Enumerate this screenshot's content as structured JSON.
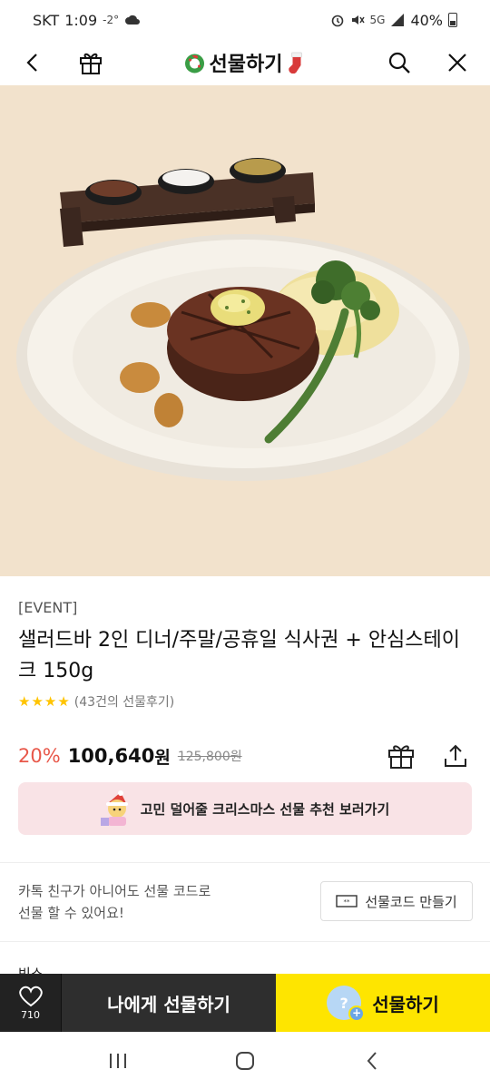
{
  "status_bar": {
    "carrier": "SKT",
    "time": "1:09",
    "temp": "-2°",
    "battery": "40%",
    "network": "5G"
  },
  "header": {
    "title": "선물하기",
    "icons": [
      "back-icon",
      "gift-box-icon",
      "wreath-icon",
      "stocking-icon",
      "search-icon",
      "close-icon"
    ]
  },
  "product": {
    "event_tag": "[EVENT]",
    "title": "샐러드바 2인 디너/주말/공휴일 식사권 + 안심스테이크 150g",
    "stars": "★★★★",
    "review_count": "(43건의 선물후기)",
    "discount": "20%",
    "price": "100,640",
    "price_unit": "원",
    "original_price": "125,800원"
  },
  "banner": {
    "text": "고민 덜어줄 크리스마스 선물 추천 보러가기"
  },
  "gift_code": {
    "note_line1": "카톡 친구가 아니어도 선물 코드로",
    "note_line2": "선물 할 수 있어요!",
    "button_label": "선물코드 만들기"
  },
  "peek_text": "빈스",
  "bottom_bar": {
    "wish_count": "710",
    "gift_to_me": "나에게 선물하기",
    "gift": "선물하기"
  },
  "colors": {
    "discount": "#e8584a",
    "gift_button": "#fee500",
    "gift_to_me_button": "#2e2e2e",
    "banner_bg": "#f9e3e6",
    "hero_bg": "#f2e2cc",
    "star": "#ffc400"
  }
}
